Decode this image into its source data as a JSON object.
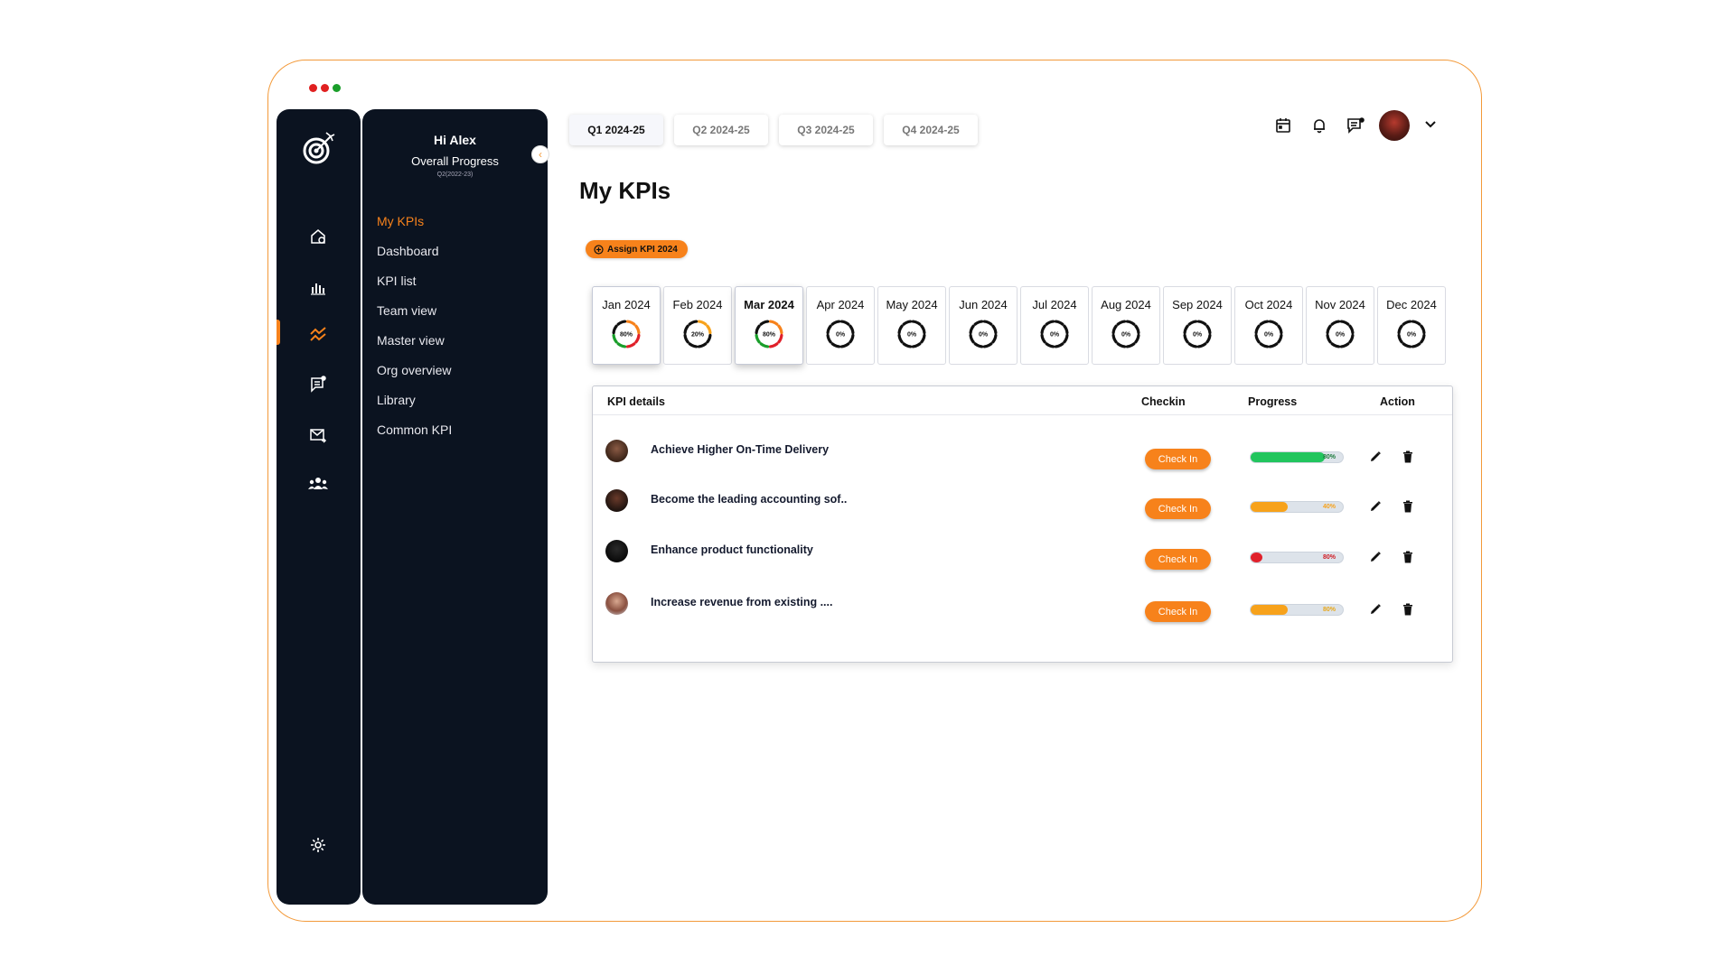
{
  "window": {
    "dots": [
      "#e02020",
      "#e02020",
      "#1a9e2a"
    ],
    "accent": "#f7821b"
  },
  "rail": {
    "logo_icon": "target-logo-icon",
    "items": [
      {
        "icon": "home-settings-icon"
      },
      {
        "icon": "bar-chart-icon"
      },
      {
        "icon": "trend-icon",
        "active": true
      },
      {
        "icon": "chat-list-icon"
      },
      {
        "icon": "mail-forward-icon"
      },
      {
        "icon": "team-icon"
      }
    ],
    "settings_icon": "gear-icon"
  },
  "panel": {
    "greeting": "Hi Alex",
    "overall_progress": "Overall Progress",
    "period": "Q2(2022-23)",
    "nav": [
      {
        "label": "My KPIs",
        "active": true
      },
      {
        "label": "Dashboard"
      },
      {
        "label": "KPI list"
      },
      {
        "label": "Team view"
      },
      {
        "label": "Master view"
      },
      {
        "label": "Org overview"
      },
      {
        "label": "Library"
      },
      {
        "label": "Common KPI"
      }
    ],
    "collapse_icon": "chevron-left-icon"
  },
  "quarters": [
    {
      "label": "Q1 2024-25",
      "active": true
    },
    {
      "label": "Q2 2024-25"
    },
    {
      "label": "Q3 2024-25"
    },
    {
      "label": "Q4 2024-25"
    }
  ],
  "header_icons": [
    "calendar-icon",
    "bell-icon",
    "message-icon",
    "avatar",
    "chevron-down-icon"
  ],
  "page": {
    "title": "My KPIs",
    "assign_button": "Assign KPI 2024"
  },
  "months": [
    {
      "label": "Jan 2024",
      "pct": "80%",
      "value": 0.8,
      "selected": true
    },
    {
      "label": "Feb 2024",
      "pct": "20%",
      "value": 0.2
    },
    {
      "label": "Mar 2024",
      "pct": "80%",
      "value": 0.8,
      "selected": true,
      "bold": true
    },
    {
      "label": "Apr 2024",
      "pct": "0%",
      "value": 0
    },
    {
      "label": "May 2024",
      "pct": "0%",
      "value": 0
    },
    {
      "label": "Jun 2024",
      "pct": "0%",
      "value": 0
    },
    {
      "label": "Jul 2024",
      "pct": "0%",
      "value": 0
    },
    {
      "label": "Aug 2024",
      "pct": "0%",
      "value": 0
    },
    {
      "label": "Sep 2024",
      "pct": "0%",
      "value": 0
    },
    {
      "label": "Oct 2024",
      "pct": "0%",
      "value": 0
    },
    {
      "label": "Nov 2024",
      "pct": "0%",
      "value": 0
    },
    {
      "label": "Dec 2024",
      "pct": "0%",
      "value": 0
    }
  ],
  "table": {
    "headers": {
      "details": "KPI details",
      "checkin": "Checkin",
      "progress": "Progress",
      "action": "Action"
    },
    "rows": [
      {
        "name": "Achieve Higher On-Time Delivery",
        "checkin": "Check In",
        "progress": 0.8,
        "pct": "80%",
        "color": "#22c55e",
        "pct_color": "#1a7a3a"
      },
      {
        "name": "Become the leading accounting sof..",
        "checkin": "Check In",
        "progress": 0.4,
        "pct": "40%",
        "color": "#f7a21b",
        "pct_color": "#f7a21b"
      },
      {
        "name": "Enhance product functionality",
        "checkin": "Check In",
        "progress": 0.1,
        "pct": "80%",
        "color": "#e0202a",
        "pct_color": "#d01a22"
      },
      {
        "name": "Increase revenue from existing ....",
        "checkin": "Check In",
        "progress": 0.4,
        "pct": "80%",
        "color": "#f7a21b",
        "pct_color": "#e8a617"
      }
    ]
  }
}
